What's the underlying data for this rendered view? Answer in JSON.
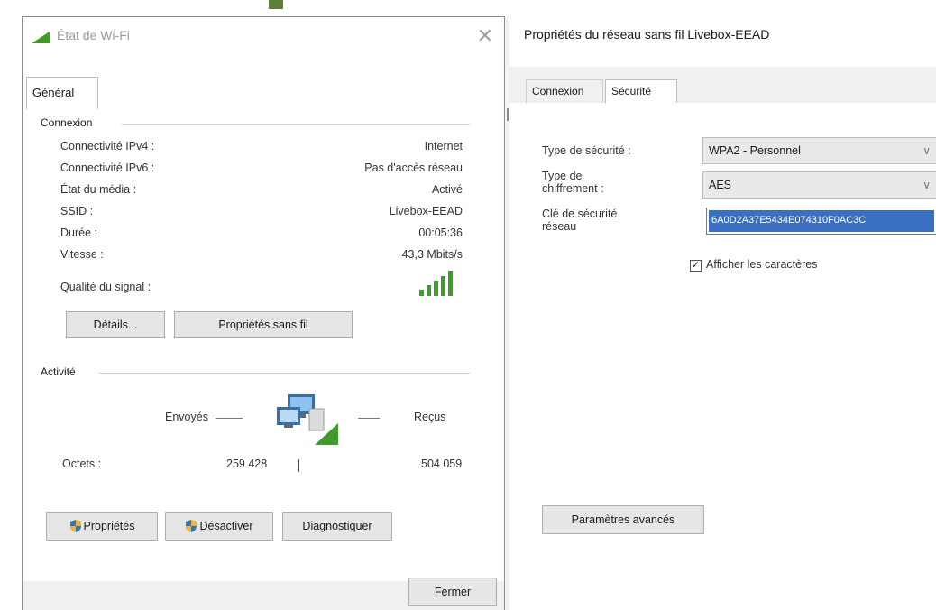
{
  "wifi_status": {
    "title": "État de Wi-Fi",
    "close_glyph": "✕",
    "tab_general": "Général",
    "connection_group": "Connexion",
    "rows": [
      {
        "label": "Connectivité IPv4 :",
        "value": "Internet"
      },
      {
        "label": "Connectivité IPv6 :",
        "value": "Pas d'accès réseau"
      },
      {
        "label": "État du média :",
        "value": "Activé"
      },
      {
        "label": "SSID :",
        "value": "Livebox-EEAD"
      },
      {
        "label": "Durée :",
        "value": "00:05:36"
      },
      {
        "label": "Vitesse :",
        "value": "43,3 Mbits/s"
      }
    ],
    "signal_label": "Qualité du signal :",
    "signal_bars": 5,
    "details_button": "Détails...",
    "wireless_props_button": "Propriétés sans fil",
    "activity_group": "Activité",
    "sent_label": "Envoyés",
    "received_label": "Reçus",
    "bytes_label": "Octets :",
    "bytes_sent": "259 428",
    "bytes_received": "504 059",
    "properties_button": "Propriétés",
    "disable_button": "Désactiver",
    "diagnose_button": "Diagnostiquer",
    "close_button": "Fermer"
  },
  "network_props": {
    "title": "Propriétés du réseau sans fil Livebox-EEAD",
    "tab_connection": "Connexion",
    "tab_security": "Sécurité",
    "security_type_label": "Type de sécurité :",
    "security_type_value": "WPA2 - Personnel",
    "encryption_label_1": "Type de",
    "encryption_label_2": "chiffrement :",
    "encryption_value": "AES",
    "key_label_1": "Clé de sécurité",
    "key_label_2": "réseau",
    "key_value": "6A0D2A37E5434E074310F0AC3C",
    "show_chars_label": "Afficher les caractères",
    "show_chars_checked": true,
    "advanced_button": "Paramètres avancés"
  },
  "colors": {
    "signal_green": "#3f9b2a",
    "selection_blue": "#3b6fc2",
    "button_face": "#e6e6e6"
  }
}
